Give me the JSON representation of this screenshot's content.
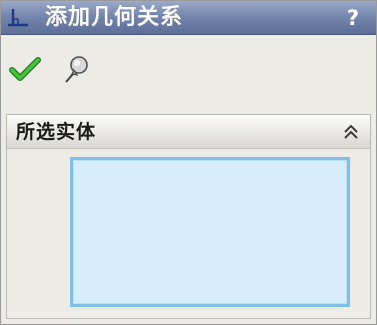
{
  "window": {
    "title": "添加几何关系",
    "help_label": "?",
    "title_icon": "add-relation-icon"
  },
  "toolbar": {
    "ok_icon": "checkmark-icon",
    "pin_icon": "pushpin-icon"
  },
  "selected_entities": {
    "title": "所选实体",
    "collapse_icon": "double-chevron-up-icon",
    "items": []
  },
  "colors": {
    "title_bar": "#7687ad",
    "ok_green": "#2ea12a",
    "selection_fill": "#d6ecfb",
    "selection_border": "#7fc0e8"
  }
}
